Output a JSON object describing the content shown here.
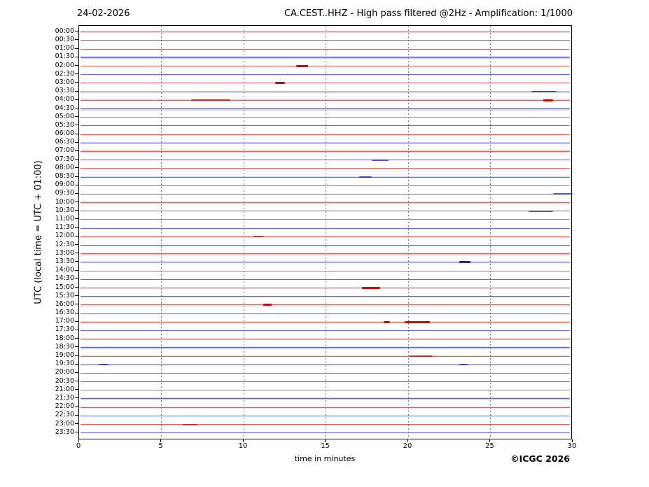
{
  "header": {
    "date": "24-02-2026",
    "title": "CA.CEST..HHZ - High pass filtered @2Hz - Amplification: 1/1000"
  },
  "footer": {
    "xlabel": "time in minutes",
    "copyright": "©ICGC 2026"
  },
  "colors": {
    "trace_red": "#e05555",
    "trace_blue": "#5b5be0",
    "noise_red": "rgba(235,110,110,0.30)",
    "noise_blue": "rgba(110,110,235,0.30)",
    "event_red": "#bb0e0e",
    "event_blue": "#2222bb",
    "grid": "#7a7a7a",
    "frame": "#000000"
  },
  "chart_data": {
    "type": "line",
    "subtype": "helicorder-seismogram",
    "date": "24-02-2026",
    "title": "CA.CEST..HHZ - High pass filtered @2Hz - Amplification: 1/1000",
    "xlabel": "time in minutes",
    "ylabel": "UTC (local time = UTC + 01:00)",
    "xlim": [
      0,
      30
    ],
    "x_ticks": [
      0,
      5,
      10,
      15,
      20,
      25,
      30
    ],
    "x_grid_minutes": [
      5,
      10,
      15,
      20,
      25
    ],
    "grid": "vertical dotted gridlines every 5 minutes",
    "legend_position": "none",
    "line_length_minutes": 30,
    "row_interval": "30 minutes per line, colors alternate red/blue",
    "rows": [
      {
        "time": "00:00",
        "color": "red",
        "noise": 1,
        "events": []
      },
      {
        "time": "00:30",
        "color": "blue",
        "noise": 0,
        "events": []
      },
      {
        "time": "01:00",
        "color": "red",
        "noise": 0,
        "events": []
      },
      {
        "time": "01:30",
        "color": "blue",
        "noise": 2,
        "events": []
      },
      {
        "time": "02:00",
        "color": "red",
        "noise": 0,
        "events": [
          [
            13.2,
            13.9,
            2
          ]
        ]
      },
      {
        "time": "02:30",
        "color": "blue",
        "noise": 0,
        "events": []
      },
      {
        "time": "03:00",
        "color": "red",
        "noise": 0,
        "events": [
          [
            11.9,
            12.5,
            2
          ]
        ]
      },
      {
        "time": "03:30",
        "color": "blue",
        "noise": 1,
        "events": [
          [
            27.5,
            29.0,
            1
          ]
        ]
      },
      {
        "time": "04:00",
        "color": "red",
        "noise": 2,
        "events": [
          [
            6.8,
            9.2,
            1
          ],
          [
            28.2,
            28.8,
            2
          ]
        ]
      },
      {
        "time": "04:30",
        "color": "blue",
        "noise": 2,
        "events": []
      },
      {
        "time": "05:00",
        "color": "red",
        "noise": 0,
        "events": []
      },
      {
        "time": "05:30",
        "color": "blue",
        "noise": 0,
        "events": []
      },
      {
        "time": "06:00",
        "color": "red",
        "noise": 1,
        "events": []
      },
      {
        "time": "06:30",
        "color": "blue",
        "noise": 1,
        "events": []
      },
      {
        "time": "07:00",
        "color": "red",
        "noise": 2,
        "events": []
      },
      {
        "time": "07:30",
        "color": "blue",
        "noise": 0,
        "events": [
          [
            17.8,
            18.8,
            1
          ]
        ]
      },
      {
        "time": "08:00",
        "color": "red",
        "noise": 0,
        "events": []
      },
      {
        "time": "08:30",
        "color": "blue",
        "noise": 1,
        "events": [
          [
            17.0,
            17.8,
            1
          ]
        ]
      },
      {
        "time": "09:00",
        "color": "red",
        "noise": 0,
        "events": []
      },
      {
        "time": "09:30",
        "color": "blue",
        "noise": 0,
        "events": [
          [
            28.8,
            30.0,
            1
          ]
        ]
      },
      {
        "time": "10:00",
        "color": "red",
        "noise": 2,
        "events": []
      },
      {
        "time": "10:30",
        "color": "blue",
        "noise": 0,
        "events": [
          [
            27.3,
            28.8,
            1
          ]
        ]
      },
      {
        "time": "11:00",
        "color": "red",
        "noise": 0,
        "events": []
      },
      {
        "time": "11:30",
        "color": "blue",
        "noise": 0,
        "events": []
      },
      {
        "time": "12:00",
        "color": "red",
        "noise": 1,
        "events": [
          [
            10.6,
            11.2,
            1
          ]
        ]
      },
      {
        "time": "12:30",
        "color": "blue",
        "noise": 1,
        "events": []
      },
      {
        "time": "13:00",
        "color": "red",
        "noise": 2,
        "events": []
      },
      {
        "time": "13:30",
        "color": "blue",
        "noise": 1,
        "events": [
          [
            23.1,
            23.8,
            2
          ]
        ]
      },
      {
        "time": "14:00",
        "color": "red",
        "noise": 0,
        "events": []
      },
      {
        "time": "14:30",
        "color": "blue",
        "noise": 0,
        "events": []
      },
      {
        "time": "15:00",
        "color": "red",
        "noise": 1,
        "events": [
          [
            17.2,
            18.3,
            2
          ]
        ]
      },
      {
        "time": "15:30",
        "color": "blue",
        "noise": 1,
        "events": []
      },
      {
        "time": "16:00",
        "color": "red",
        "noise": 2,
        "events": [
          [
            11.2,
            11.7,
            2
          ]
        ]
      },
      {
        "time": "16:30",
        "color": "blue",
        "noise": 0,
        "events": []
      },
      {
        "time": "17:00",
        "color": "red",
        "noise": 1,
        "events": [
          [
            18.5,
            18.9,
            2
          ],
          [
            19.8,
            21.3,
            2
          ]
        ]
      },
      {
        "time": "17:30",
        "color": "blue",
        "noise": 0,
        "events": []
      },
      {
        "time": "18:00",
        "color": "red",
        "noise": 1,
        "events": []
      },
      {
        "time": "18:30",
        "color": "blue",
        "noise": 2,
        "events": []
      },
      {
        "time": "19:00",
        "color": "red",
        "noise": 1,
        "events": [
          [
            20.1,
            21.5,
            1
          ]
        ]
      },
      {
        "time": "19:30",
        "color": "blue",
        "noise": 1,
        "events": [
          [
            1.2,
            1.8,
            1
          ],
          [
            23.1,
            23.6,
            1
          ]
        ]
      },
      {
        "time": "20:00",
        "color": "red",
        "noise": 0,
        "events": []
      },
      {
        "time": "20:30",
        "color": "blue",
        "noise": 0,
        "events": []
      },
      {
        "time": "21:00",
        "color": "red",
        "noise": 0,
        "events": []
      },
      {
        "time": "21:30",
        "color": "blue",
        "noise": 2,
        "events": []
      },
      {
        "time": "22:00",
        "color": "red",
        "noise": 1,
        "events": []
      },
      {
        "time": "22:30",
        "color": "blue",
        "noise": 0,
        "events": []
      },
      {
        "time": "23:00",
        "color": "red",
        "noise": 1,
        "events": [
          [
            6.3,
            7.2,
            1
          ]
        ]
      },
      {
        "time": "23:30",
        "color": "blue",
        "noise": 0,
        "events": []
      }
    ]
  }
}
